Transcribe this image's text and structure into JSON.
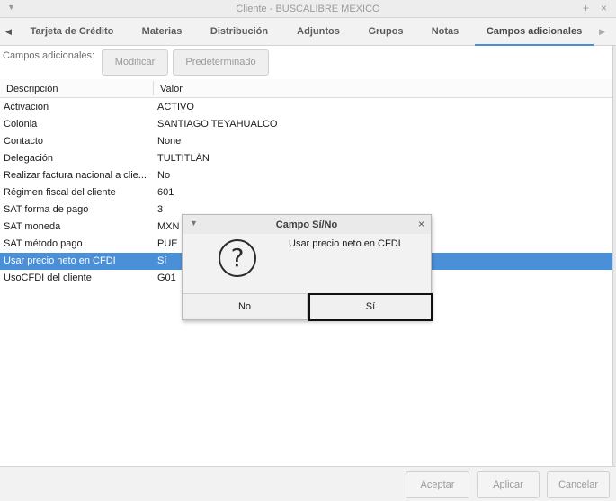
{
  "window": {
    "title": "Cliente - BUSCALIBRE MEXICO",
    "menu_icon": "chevron-down-icon",
    "minimize_glyph": "+",
    "close_glyph": "×"
  },
  "tabs": [
    {
      "label": "Tarjeta de Crédito"
    },
    {
      "label": "Materias"
    },
    {
      "label": "Distribución"
    },
    {
      "label": "Adjuntos"
    },
    {
      "label": "Grupos"
    },
    {
      "label": "Notas"
    },
    {
      "label": "Campos adicionales",
      "active": true
    }
  ],
  "toolbar": {
    "label": "Campos adicionales:",
    "modify_label": "Modificar",
    "default_label": "Predeterminado"
  },
  "table": {
    "columns": [
      "Descripción",
      "Valor"
    ],
    "rows": [
      {
        "desc": "Activación",
        "value": "ACTIVO"
      },
      {
        "desc": "Colonia",
        "value": "SANTIAGO TEYAHUALCO"
      },
      {
        "desc": "Contacto",
        "value": "None"
      },
      {
        "desc": "Delegación",
        "value": "TULTITLÁN"
      },
      {
        "desc": "Realizar factura nacional a clie...",
        "value": "No"
      },
      {
        "desc": "Régimen fiscal del cliente",
        "value": "601"
      },
      {
        "desc": "SAT forma de pago",
        "value": "3"
      },
      {
        "desc": "SAT moneda",
        "value": "MXN"
      },
      {
        "desc": "SAT método pago",
        "value": "PUE"
      },
      {
        "desc": "Usar precio neto en CFDI",
        "value": "Sí",
        "selected": true
      },
      {
        "desc": "UsoCFDI del cliente",
        "value": "G01"
      }
    ]
  },
  "footer": {
    "accept_label": "Aceptar",
    "apply_label": "Aplicar",
    "cancel_label": "Cancelar"
  },
  "dialog": {
    "title": "Campo Sí/No",
    "message": "Usar precio neto en CFDI",
    "icon": "question-icon",
    "icon_glyph": "?",
    "no_label": "No",
    "yes_label": "Sí",
    "close_glyph": "×"
  },
  "colors": {
    "selection": "#4a90d9",
    "tab_underline": "#4a90d9"
  }
}
